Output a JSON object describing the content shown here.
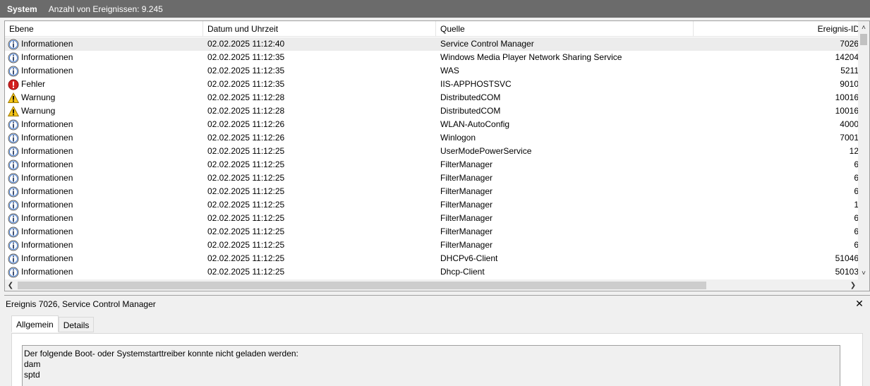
{
  "titlebar": {
    "title": "System",
    "count_text": "Anzahl von Ereignissen: 9.245"
  },
  "columns": {
    "level": "Ebene",
    "date": "Datum und Uhrzeit",
    "source": "Quelle",
    "event_id": "Ereignis-ID"
  },
  "events": [
    {
      "level": "Informationen",
      "icon": "info-icon",
      "date": "02.02.2025 11:12:40",
      "source": "Service Control Manager",
      "id": "7026",
      "selected": true
    },
    {
      "level": "Informationen",
      "icon": "info-icon",
      "date": "02.02.2025 11:12:35",
      "source": "Windows Media Player Network Sharing Service",
      "id": "14204"
    },
    {
      "level": "Informationen",
      "icon": "info-icon",
      "date": "02.02.2025 11:12:35",
      "source": "WAS",
      "id": "5211"
    },
    {
      "level": "Fehler",
      "icon": "error-icon",
      "date": "02.02.2025 11:12:35",
      "source": "IIS-APPHOSTSVC",
      "id": "9010"
    },
    {
      "level": "Warnung",
      "icon": "warning-icon",
      "date": "02.02.2025 11:12:28",
      "source": "DistributedCOM",
      "id": "10016"
    },
    {
      "level": "Warnung",
      "icon": "warning-icon",
      "date": "02.02.2025 11:12:28",
      "source": "DistributedCOM",
      "id": "10016"
    },
    {
      "level": "Informationen",
      "icon": "info-icon",
      "date": "02.02.2025 11:12:26",
      "source": "WLAN-AutoConfig",
      "id": "4000"
    },
    {
      "level": "Informationen",
      "icon": "info-icon",
      "date": "02.02.2025 11:12:26",
      "source": "Winlogon",
      "id": "7001"
    },
    {
      "level": "Informationen",
      "icon": "info-icon",
      "date": "02.02.2025 11:12:25",
      "source": "UserModePowerService",
      "id": "12"
    },
    {
      "level": "Informationen",
      "icon": "info-icon",
      "date": "02.02.2025 11:12:25",
      "source": "FilterManager",
      "id": "6"
    },
    {
      "level": "Informationen",
      "icon": "info-icon",
      "date": "02.02.2025 11:12:25",
      "source": "FilterManager",
      "id": "6"
    },
    {
      "level": "Informationen",
      "icon": "info-icon",
      "date": "02.02.2025 11:12:25",
      "source": "FilterManager",
      "id": "6"
    },
    {
      "level": "Informationen",
      "icon": "info-icon",
      "date": "02.02.2025 11:12:25",
      "source": "FilterManager",
      "id": "1"
    },
    {
      "level": "Informationen",
      "icon": "info-icon",
      "date": "02.02.2025 11:12:25",
      "source": "FilterManager",
      "id": "6"
    },
    {
      "level": "Informationen",
      "icon": "info-icon",
      "date": "02.02.2025 11:12:25",
      "source": "FilterManager",
      "id": "6"
    },
    {
      "level": "Informationen",
      "icon": "info-icon",
      "date": "02.02.2025 11:12:25",
      "source": "FilterManager",
      "id": "6"
    },
    {
      "level": "Informationen",
      "icon": "info-icon",
      "date": "02.02.2025 11:12:25",
      "source": "DHCPv6-Client",
      "id": "51046"
    },
    {
      "level": "Informationen",
      "icon": "info-icon",
      "date": "02.02.2025 11:12:25",
      "source": "Dhcp-Client",
      "id": "50103"
    }
  ],
  "scrollbars": {
    "vertical_icons": [
      "chevron-up-icon",
      "chevron-down-icon"
    ],
    "horizontal_icons": [
      "chevron-left-icon",
      "chevron-right-icon"
    ]
  },
  "detail": {
    "title": "Ereignis 7026, Service Control Manager",
    "close_icon": "close-icon",
    "tabs": [
      "Allgemein",
      "Details"
    ],
    "active_tab": "Allgemein",
    "message_lines": [
      "Der folgende Boot- oder Systemstarttreiber konnte nicht geladen werden:",
      "dam",
      "sptd"
    ]
  },
  "colors": {
    "titlebar_bg": "#6b6b6b",
    "info_blue": "#2a6fd6",
    "error_red": "#d32020",
    "warning_yellow": "#f5c518",
    "selected_row": "#ececec"
  }
}
